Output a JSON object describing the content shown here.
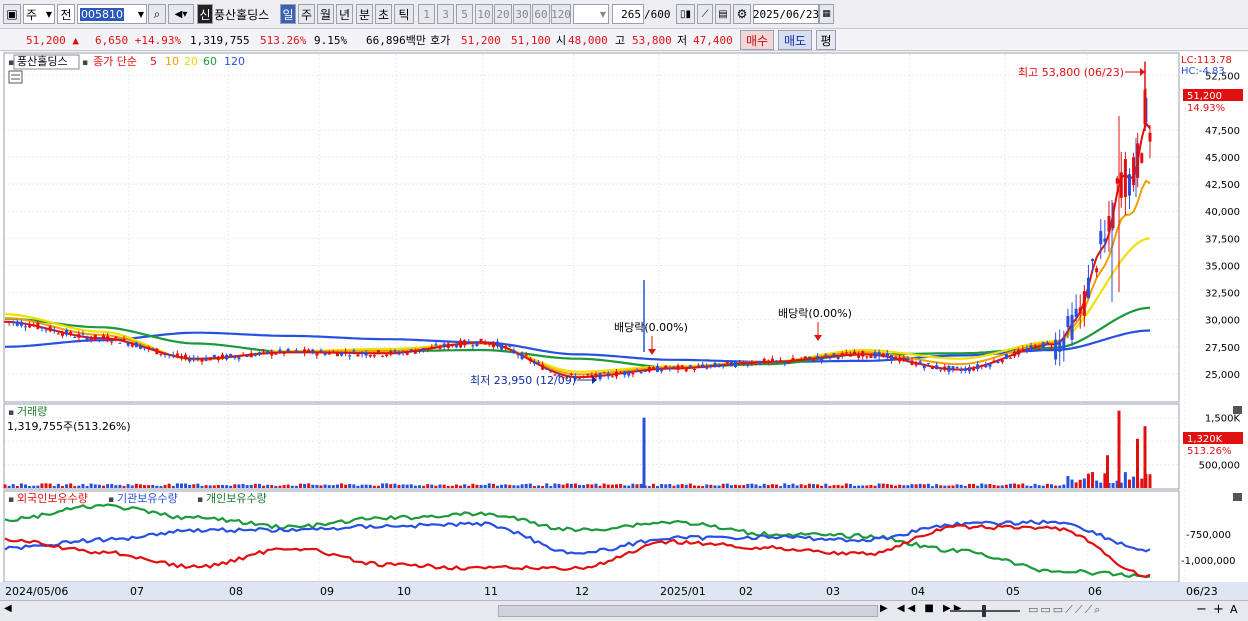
{
  "toolbar": {
    "item1": "주",
    "item2": "전",
    "code": "005810",
    "sin_label": "신",
    "stock_name": "풍산홀딩스",
    "periods": [
      "일",
      "주",
      "월",
      "년",
      "분",
      "초",
      "틱"
    ],
    "intervals": [
      "1",
      "3",
      "5",
      "10",
      "20",
      "30",
      "60",
      "120"
    ],
    "count": "265",
    "count_total": "/600",
    "date": "2025/06/23"
  },
  "info": {
    "price": "51,200",
    "change": "6,650",
    "change_pct": "+14.93%",
    "volume": "1,319,755",
    "vol_ratio": "513.26%",
    "turnover": "9.15%",
    "amount": "66,896백만",
    "quote_label": "호가",
    "ask": "51,200",
    "bid": "51,100",
    "open_label": "시",
    "open": "48,000",
    "high_label": "고",
    "high": "53,800",
    "low_label": "저",
    "low": "47,400",
    "buy_label": "매수",
    "sell_label": "매도",
    "eval_label": "평"
  },
  "chart_data": [
    {
      "type": "candlestick",
      "title": "풍산홀딩스",
      "price_label": "종가 단순",
      "ma_labels": [
        "5",
        "10",
        "20",
        "60",
        "120"
      ],
      "colors": {
        "ma5": "#e01010",
        "ma10": "#f0a000",
        "ma20": "#f0e000",
        "ma60": "#1a9a3a",
        "ma120": "#2850e0",
        "up": "#e01010",
        "down": "#2850e0"
      },
      "ylim": [
        22500,
        54500
      ],
      "y_ticks": [
        25000,
        27500,
        30000,
        32500,
        35000,
        37500,
        40000,
        42500,
        45000,
        47500,
        52500
      ],
      "y_tick_labels": [
        "25,000",
        "27,500",
        "30,000",
        "32,500",
        "35,000",
        "37,500",
        "40,000",
        "42,500",
        "45,000",
        "47,500",
        "52,500"
      ],
      "right_labels": {
        "lc": "LC:113.78",
        "hc": "HC:-4.83",
        "current": "51,200",
        "current_pct": "14.93%"
      },
      "annotations": [
        {
          "text": "최고 53,800 (06/23)",
          "value": 53800
        },
        {
          "text": "최저 23,950 (12/09)",
          "value": 23950
        },
        {
          "text": "배당락(0.00%)",
          "date": "2024/12/27"
        },
        {
          "text": "배당락(0.00%)",
          "date": "2025/03/27"
        }
      ],
      "x_labels": [
        "2024/05/06",
        "07",
        "08",
        "09",
        "10",
        "11",
        "12",
        "2025/01",
        "02",
        "03",
        "04",
        "05",
        "06",
        "06/23"
      ],
      "ma_series": {
        "ma5": [
          29800,
          28300,
          26400,
          27000,
          26900,
          27900,
          24700,
          25500,
          26100,
          26800,
          25400,
          27700,
          44500
        ],
        "ma20": [
          30500,
          28900,
          26300,
          27100,
          27300,
          27800,
          25200,
          25700,
          26100,
          27200,
          26400,
          28000,
          37500
        ],
        "ma60": [
          30100,
          29300,
          27800,
          27000,
          27100,
          27200,
          26400,
          25600,
          25900,
          26800,
          26900,
          27400,
          31100
        ],
        "ma120": [
          27500,
          28100,
          28800,
          28500,
          28200,
          27900,
          26800,
          26300,
          26100,
          26200,
          26700,
          27200,
          29000
        ]
      }
    },
    {
      "type": "bar",
      "title": "거래량",
      "subtitle": "1,319,755주(513.26%)",
      "y_ticks": [
        500000,
        1000000,
        1500000
      ],
      "y_tick_labels": [
        "500,000",
        "1,000,000",
        "1,500,000"
      ],
      "y_tick_display": [
        "500,000",
        "",
        "1,500K"
      ],
      "right_labels": {
        "current": "1,320K",
        "current_pct": "513.26%"
      },
      "ylim": [
        0,
        1750000
      ],
      "peaks": [
        {
          "date": "2024/12/27",
          "value": 1500000
        },
        {
          "date": "2025/06/16",
          "value": 1650000
        },
        {
          "date": "2025/06/23",
          "value": 1319755
        }
      ]
    },
    {
      "type": "line",
      "series": [
        {
          "name": "외국인보유수량",
          "color": "#e01010"
        },
        {
          "name": "기관보유수량",
          "color": "#2850e0"
        },
        {
          "name": "개인보유수량",
          "color": "#1a9a3a"
        }
      ],
      "y_tick_labels": [
        "-750,000",
        "-1,000,000"
      ]
    }
  ],
  "bottom": {
    "scroll_left": "◀",
    "zoom_out": "−",
    "zoom_in": "+",
    "letter": "A"
  }
}
